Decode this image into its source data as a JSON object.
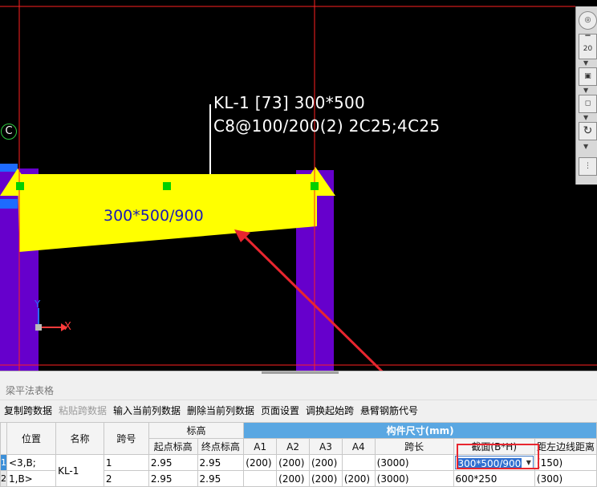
{
  "canvas": {
    "beam_annotation_line1": "KL-1 [73] 300*500",
    "beam_annotation_line2": "C8@100/200(2) 2C25;4C25",
    "section_label": "300*500/900",
    "axis_marker": "C",
    "coord_y": "Y",
    "coord_x": "X",
    "colors": {
      "background": "#000000",
      "beam": "#ffff00",
      "column": "#6600cc",
      "gridline": "#ff0000",
      "arrow": "#e8262f"
    }
  },
  "view_toolbar": {
    "zoom_label": "20",
    "icons": [
      "orbit-icon",
      "zoom-level-icon",
      "cube-view-icon",
      "cube-box-icon",
      "rotate-icon",
      "dots-icon"
    ]
  },
  "panel": {
    "title": "梁平法表格",
    "toolbar": [
      {
        "label": "复制跨数据",
        "enabled": true
      },
      {
        "label": "粘贴跨数据",
        "enabled": false
      },
      {
        "label": "输入当前列数据",
        "enabled": true
      },
      {
        "label": "删除当前列数据",
        "enabled": true
      },
      {
        "label": "页面设置",
        "enabled": true
      },
      {
        "label": "调换起始跨",
        "enabled": true
      },
      {
        "label": "悬臂钢筋代号",
        "enabled": true
      }
    ],
    "headers": {
      "position": "位置",
      "name": "名称",
      "span_no": "跨号",
      "elevation_group": "标高",
      "start_elev": "起点标高",
      "end_elev": "终点标高",
      "size_group": "构件尺寸(mm)",
      "a1": "A1",
      "a2": "A2",
      "a3": "A3",
      "a4": "A4",
      "span_length": "跨长",
      "section": "截面(B*H)",
      "left_dist": "距左边线距离"
    },
    "rows": [
      {
        "num": "1",
        "position": "<3,B;",
        "name": "KL-1",
        "span_no": "1",
        "start_elev": "2.95",
        "end_elev": "2.95",
        "a1": "(200)",
        "a2": "(200)",
        "a3": "(200)",
        "a4": "",
        "span_length": "(3000)",
        "section": "300*500/900",
        "left_dist": "(150)"
      },
      {
        "num": "2",
        "position": "1,B>",
        "name": "",
        "span_no": "2",
        "start_elev": "2.95",
        "end_elev": "2.95",
        "a1": "",
        "a2": "(200)",
        "a3": "(200)",
        "a4": "(200)",
        "span_length": "(3000)",
        "section": "600*250",
        "left_dist": "(300)"
      }
    ]
  }
}
